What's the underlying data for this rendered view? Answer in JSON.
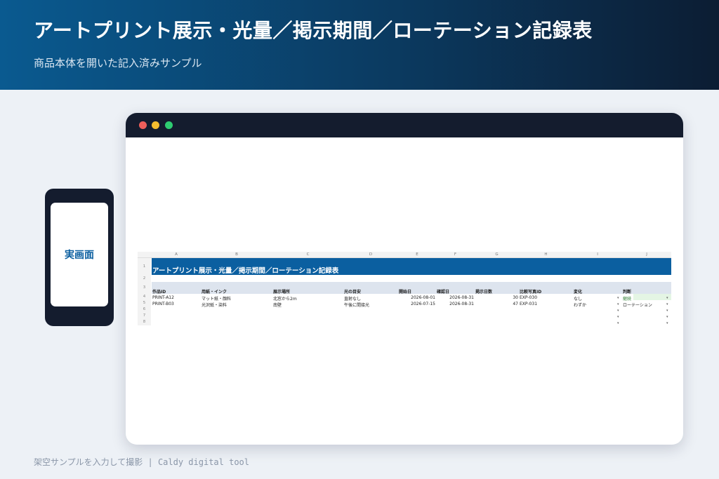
{
  "banner": {
    "title": "アートプリント展示・光量／掲示期間／ローテーション記録表",
    "subtitle": "商品本体を開いた記入済みサンプル"
  },
  "phone": {
    "label": "実画面"
  },
  "colors": {
    "banner_start": "#0a5a90",
    "banner_end": "#0c1d33",
    "sheet_title_bg": "#0b5fa0",
    "header_bg": "#dde4ee",
    "judgement_highlight": "#e4f5e4"
  },
  "window": {
    "dots": [
      "red",
      "yellow",
      "green"
    ]
  },
  "sheet": {
    "columns": [
      "A",
      "B",
      "C",
      "D",
      "E",
      "F",
      "G",
      "H",
      "I",
      "J"
    ],
    "row_numbers": [
      "1",
      "2",
      "3",
      "4",
      "5",
      "6",
      "7",
      "8"
    ],
    "title": "アートプリント展示・光量／掲示期間／ローテーション記録表",
    "headers": [
      "作品ID",
      "用紙・インク",
      "展示場所",
      "光の目安",
      "開始日",
      "確認日",
      "掲示日数",
      "比較写真ID",
      "変化",
      "判断"
    ],
    "rows": [
      {
        "id": "PRINT-A12",
        "paper": "マット紙・顔料",
        "place": "北窓から2m",
        "light": "直射なし",
        "start": "2026-08-01",
        "check": "2026-08-31",
        "days": "30",
        "photo": "EXP-030",
        "change": "なし",
        "judge": "継続"
      },
      {
        "id": "PRINT-B03",
        "paper": "光沢紙・染料",
        "place": "南壁",
        "light": "午後に間接光",
        "start": "2026-07-15",
        "check": "2026-08-31",
        "days": "47",
        "photo": "EXP-031",
        "change": "わずか",
        "judge": "ローテーション"
      }
    ],
    "dropdown_marker": "▾"
  },
  "footer": {
    "text": "架空サンプルを入力して撮影 | Caldy digital tool"
  }
}
